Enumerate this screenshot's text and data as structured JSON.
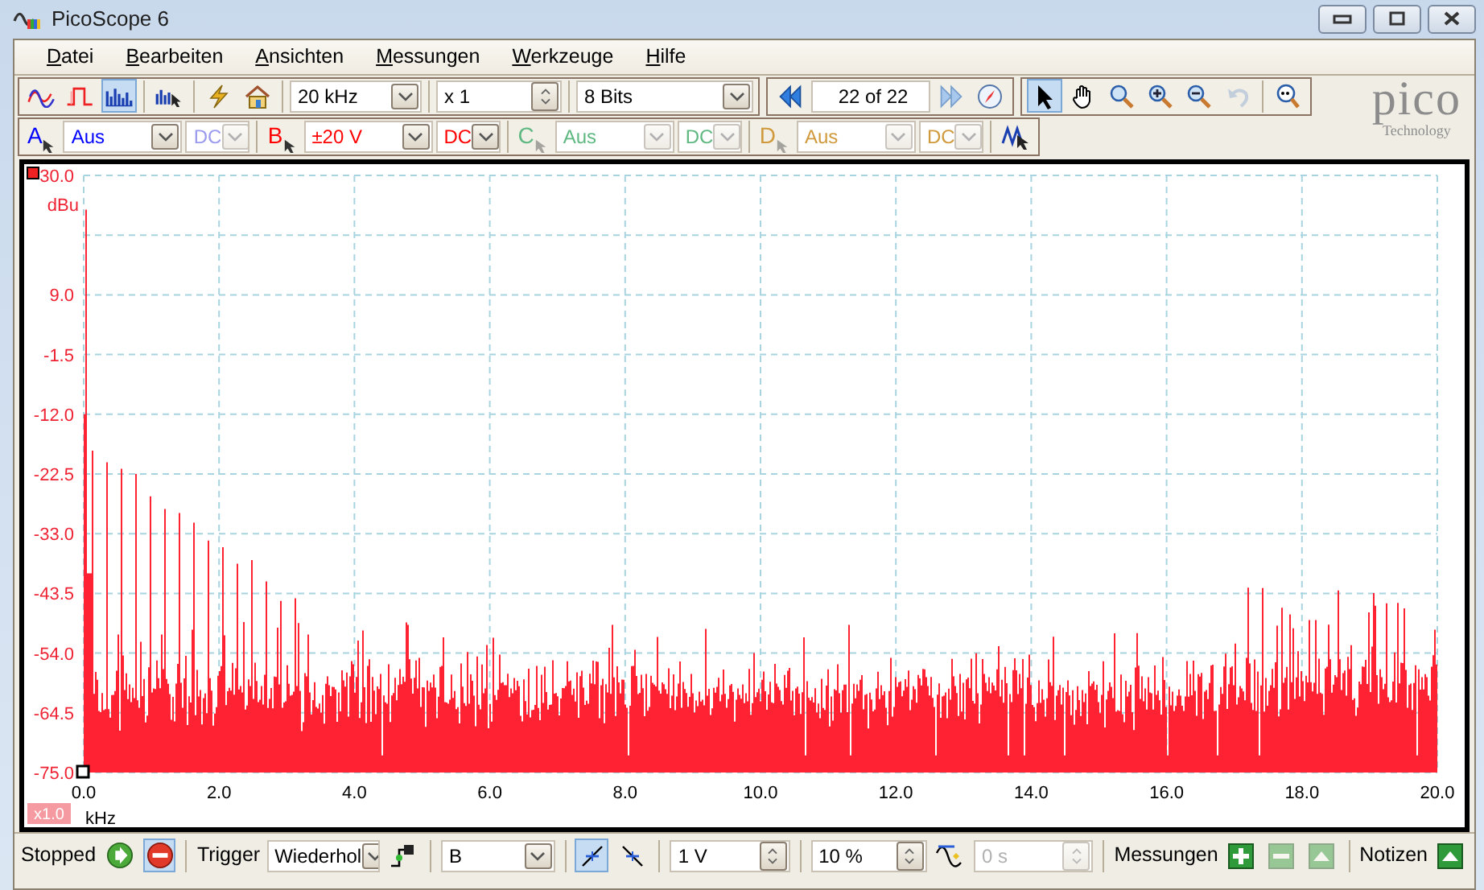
{
  "window": {
    "title": "PicoScope 6"
  },
  "menu": [
    {
      "label": "Datei"
    },
    {
      "label": "Bearbeiten"
    },
    {
      "label": "Ansichten"
    },
    {
      "label": "Messungen"
    },
    {
      "label": "Werkzeuge"
    },
    {
      "label": "Hilfe"
    }
  ],
  "toolbar": {
    "view_modes": [
      {
        "kind": "scope",
        "selected": false
      },
      {
        "kind": "persistence",
        "selected": false
      },
      {
        "kind": "spectrum",
        "selected": true
      }
    ],
    "timebase": "20 kHz",
    "multiplier": "x 1",
    "resolution": "8 Bits",
    "buffer": "22 of 22",
    "tools": [
      {
        "kind": "pointer",
        "selected": true,
        "disabled": false
      },
      {
        "kind": "hand",
        "selected": false,
        "disabled": false
      },
      {
        "kind": "zoom-area",
        "selected": false,
        "disabled": false
      },
      {
        "kind": "zoom-in",
        "selected": false,
        "disabled": false
      },
      {
        "kind": "zoom-out",
        "selected": false,
        "disabled": false
      },
      {
        "kind": "undo",
        "selected": false,
        "disabled": true
      },
      {
        "kind": "zoom-full",
        "selected": false,
        "disabled": false
      }
    ]
  },
  "logo": {
    "name": "pico",
    "tagline": "Technology"
  },
  "channels": [
    {
      "label": "A",
      "range": "Aus",
      "coupling": "DC",
      "color": "#0000ff",
      "disabled": false,
      "coupling_disabled": true
    },
    {
      "label": "B",
      "range": "±20 V",
      "coupling": "DC",
      "color": "#ff0000",
      "disabled": false,
      "coupling_disabled": false
    },
    {
      "label": "C",
      "range": "Aus",
      "coupling": "DC",
      "color": "#5fb882",
      "disabled": true,
      "coupling_disabled": true
    },
    {
      "label": "D",
      "range": "Aus",
      "coupling": "DC",
      "color": "#d09a3c",
      "disabled": true,
      "coupling_disabled": true
    }
  ],
  "plot": {
    "y_unit": "dBu",
    "y_ticks": [
      "30.0",
      "9.0",
      "-1.5",
      "-12.0",
      "-22.5",
      "-33.0",
      "-43.5",
      "-54.0",
      "-64.5",
      "-75.0"
    ],
    "x_ticks": [
      "0.0",
      "2.0",
      "4.0",
      "6.0",
      "8.0",
      "10.0",
      "12.0",
      "14.0",
      "16.0",
      "18.0",
      "20.0"
    ],
    "x_unit": "kHz",
    "zoom": "x1.0"
  },
  "status_bar": {
    "state": "Stopped",
    "run_buttons": [
      {
        "kind": "start",
        "selected": false
      },
      {
        "kind": "stop",
        "selected": true
      }
    ],
    "trigger_label": "Trigger",
    "trigger_mode": "Wiederhol",
    "trigger_source": "B",
    "edges": [
      {
        "kind": "rising",
        "selected": true
      },
      {
        "kind": "falling",
        "selected": false
      }
    ],
    "threshold": "1 V",
    "pretrigger": "10 %",
    "delay": {
      "value": "0 s",
      "disabled": true
    },
    "measurements_label": "Messungen",
    "measure_buttons": [
      {
        "kind": "add",
        "disabled": false
      },
      {
        "kind": "remove",
        "disabled": true
      },
      {
        "kind": "edit",
        "disabled": true
      }
    ],
    "notes_label": "Notizen"
  }
}
